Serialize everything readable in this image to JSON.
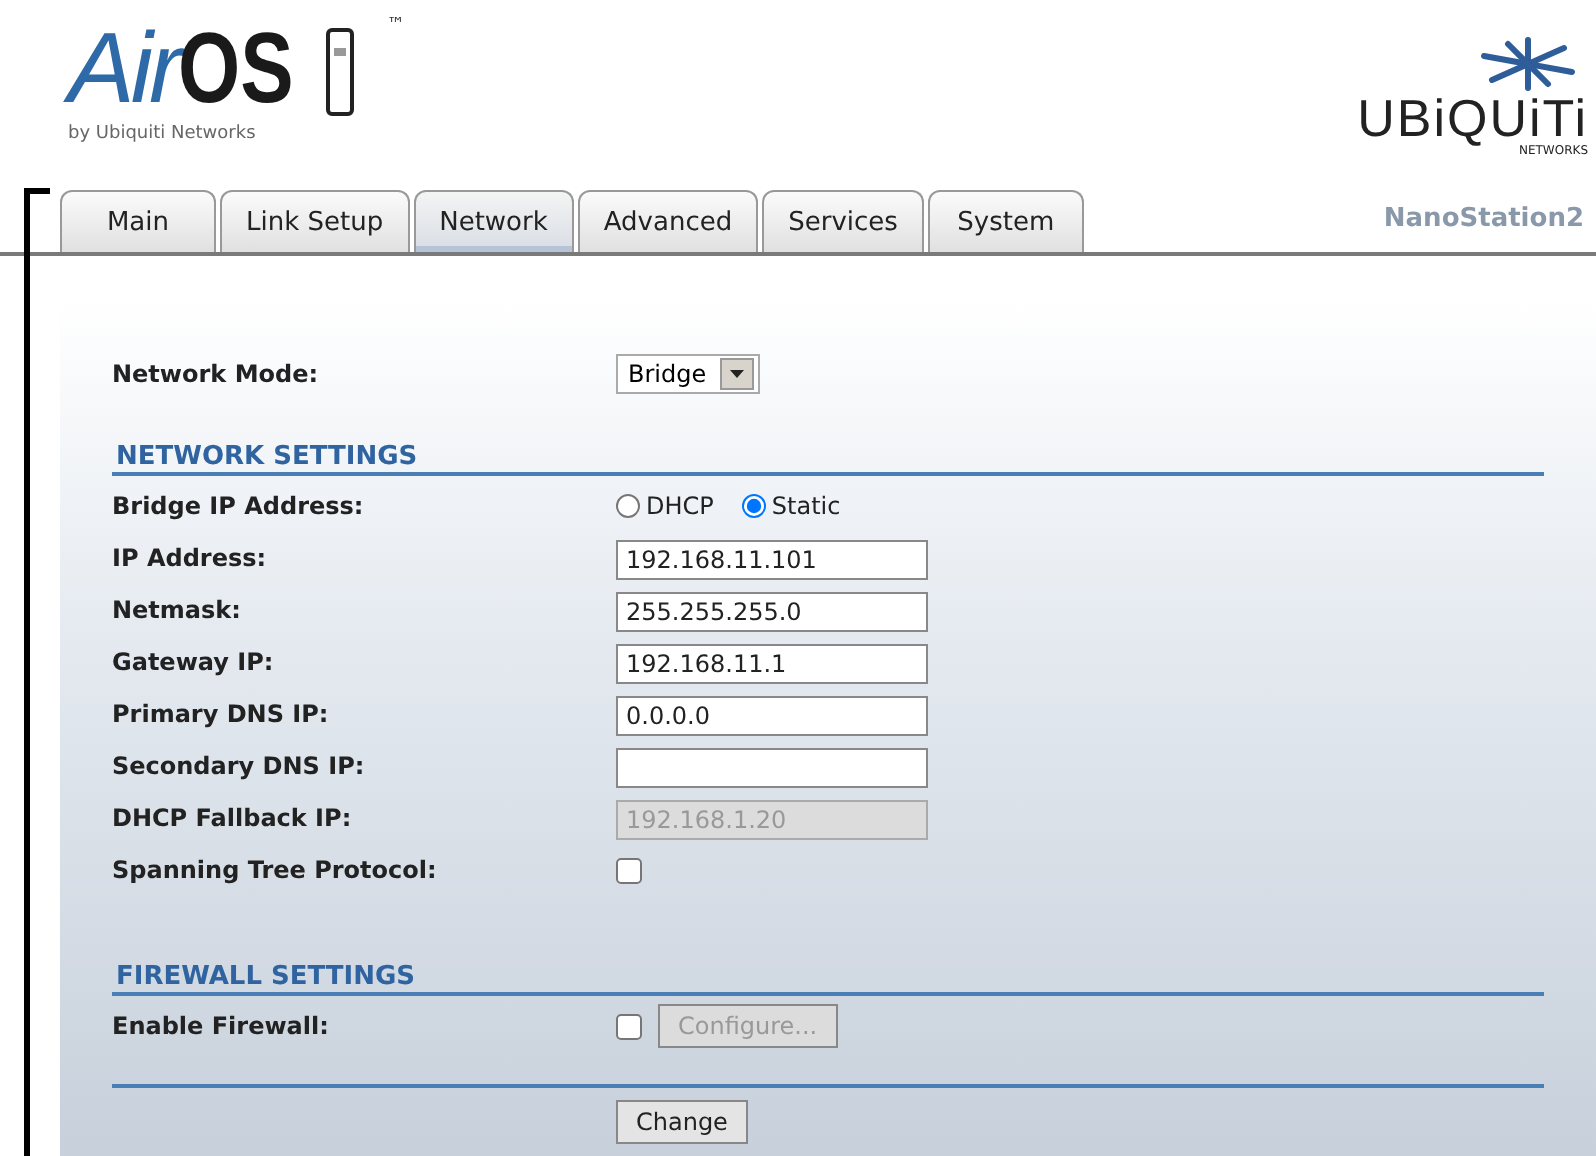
{
  "logo": {
    "air": "Air",
    "os": "OS",
    "tm": "™",
    "byline": "by Ubiquiti Networks"
  },
  "brand": {
    "name": "UBiQUiTi",
    "sub": "NETWORKS"
  },
  "tabs": [
    {
      "label": "Main",
      "selected": false
    },
    {
      "label": "Link Setup",
      "selected": false
    },
    {
      "label": "Network",
      "selected": true
    },
    {
      "label": "Advanced",
      "selected": false
    },
    {
      "label": "Services",
      "selected": false
    },
    {
      "label": "System",
      "selected": false
    }
  ],
  "device_name": "NanoStation2",
  "network_mode": {
    "label": "Network Mode:",
    "value": "Bridge"
  },
  "sections": [
    {
      "title": "NETWORK SETTINGS",
      "rows": [
        {
          "kind": "radio",
          "label": "Bridge IP Address:",
          "options": [
            {
              "label": "DHCP",
              "selected": false
            },
            {
              "label": "Static",
              "selected": true
            }
          ]
        },
        {
          "kind": "text",
          "label": "IP Address:",
          "value": "192.168.11.101",
          "disabled": false
        },
        {
          "kind": "text",
          "label": "Netmask:",
          "value": "255.255.255.0",
          "disabled": false
        },
        {
          "kind": "text",
          "label": "Gateway IP:",
          "value": "192.168.11.1",
          "disabled": false
        },
        {
          "kind": "text",
          "label": "Primary DNS IP:",
          "value": "0.0.0.0",
          "disabled": false
        },
        {
          "kind": "text",
          "label": "Secondary DNS IP:",
          "disabled": false
        },
        {
          "kind": "text",
          "label": "DHCP Fallback IP:",
          "value": "192.168.1.20",
          "disabled": true
        },
        {
          "kind": "checkbox",
          "label": "Spanning Tree Protocol:",
          "checked": false
        }
      ]
    },
    {
      "title": "FIREWALL SETTINGS",
      "rows": [
        {
          "kind": "checkbox",
          "label": "Enable Firewall:",
          "checked": false,
          "button": {
            "label": "Configure...",
            "disabled": true
          }
        }
      ]
    }
  ],
  "submit": "Change"
}
